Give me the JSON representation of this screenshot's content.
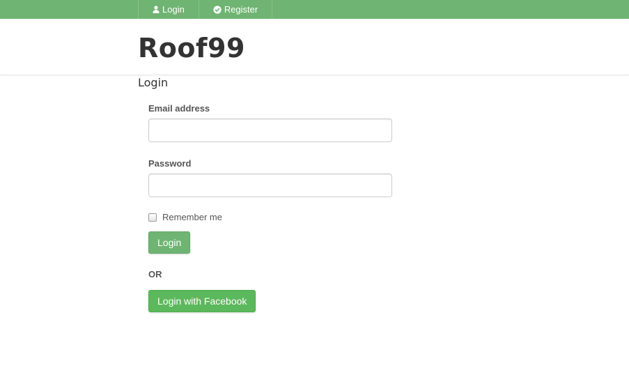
{
  "colors": {
    "topbar": "#6fb472",
    "login_button": "#6fb472",
    "facebook_button": "#5cb85c"
  },
  "topnav": {
    "items": [
      {
        "label": "Login",
        "icon": "user-icon"
      },
      {
        "label": "Register",
        "icon": "check-circle-icon"
      }
    ]
  },
  "header": {
    "brand": "Roof99"
  },
  "page": {
    "title": "Login"
  },
  "form": {
    "email_label": "Email address",
    "email_value": "",
    "password_label": "Password",
    "password_value": "",
    "remember_label": "Remember me",
    "remember_checked": false,
    "login_button": "Login",
    "or_text": "OR",
    "facebook_button": "Login with Facebook"
  }
}
